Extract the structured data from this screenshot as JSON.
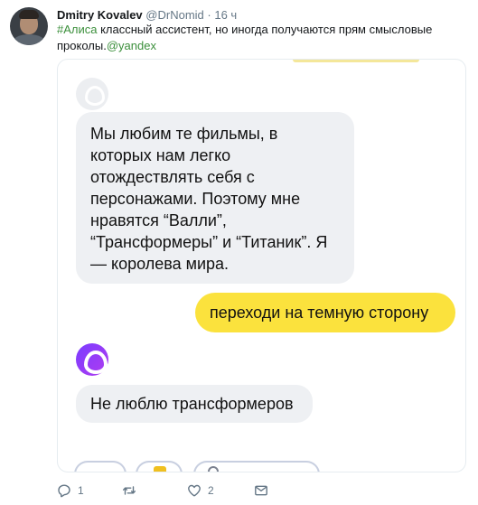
{
  "tweet": {
    "author_name": "Dmitry Kovalev",
    "handle": "@DrNomid",
    "separator": "·",
    "time": "16 ч",
    "text_hashtag": "#Алиса",
    "text_body": " классный ассистент, но иногда получаются прям смысловые проколы.",
    "text_mention": "@yandex"
  },
  "media": {
    "alice_reply_1": "Мы любим те фильмы, в которых нам легко отождествлять себя с персонажами. Поэтому мне нравятся “Валли”, “Трансформеры” и “Титаник”. Я — королева мира.",
    "user_message": "переходи на темную сторону",
    "alice_reply_2": "Не люблю трансформеров",
    "colors": {
      "user_bubble": "#fbe23d",
      "alice_bubble": "#eef0f3",
      "alice_accent": "#8b3cf7"
    }
  },
  "actions": {
    "reply_count": "1",
    "retweet_count": "",
    "like_count": "2",
    "icons": [
      "reply-icon",
      "retweet-icon",
      "like-icon",
      "direct-message-icon"
    ]
  }
}
